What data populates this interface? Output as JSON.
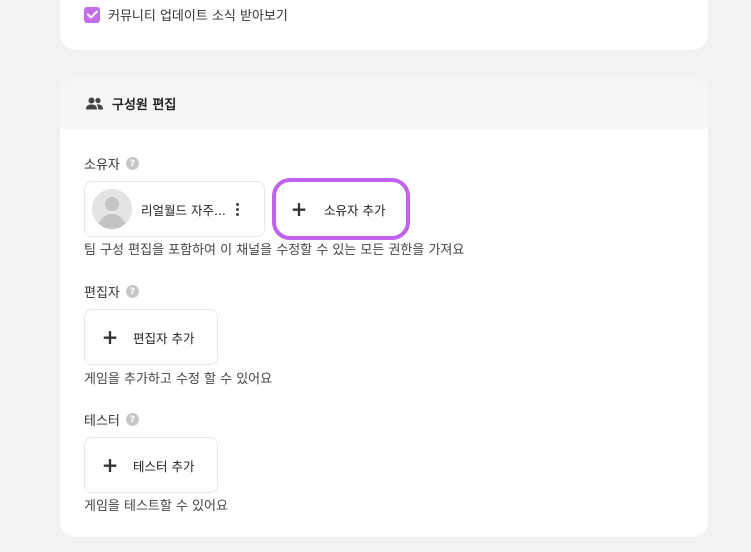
{
  "top_card": {
    "checkbox_label": "커뮤니티 업데이트 소식 받아보기",
    "checkbox_checked": true
  },
  "team_card": {
    "title": "구성원 편집",
    "owner": {
      "label": "소유자",
      "member_name": "리얼월드 자주...",
      "add_label": "소유자 추가",
      "description": "팀 구성 편집을 포함하여 이 채널을 수정할 수 있는 모든 권한을 가져요"
    },
    "editor": {
      "label": "편집자",
      "add_label": "편집자 추가",
      "description": "게임을 추가하고 수정 할 수 있어요"
    },
    "tester": {
      "label": "테스터",
      "add_label": "테스터 추가",
      "description": "게임을 테스트할 수 있어요"
    }
  },
  "colors": {
    "accent": "#c063ee",
    "checkbox": "#c26ee8",
    "page_background": "#f2f2f2"
  },
  "icons": {
    "header": "users-icon",
    "help": "help-icon",
    "menu": "kebab-menu-icon",
    "add": "plus-icon",
    "check": "check-icon"
  }
}
